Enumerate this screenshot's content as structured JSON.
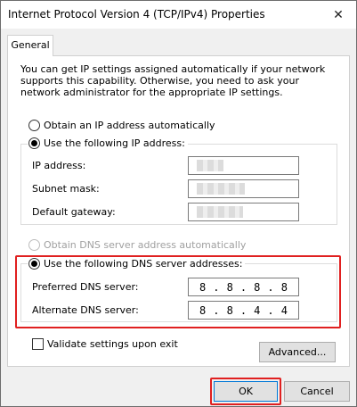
{
  "window": {
    "title": "Internet Protocol Version 4 (TCP/IPv4) Properties",
    "close_glyph": "✕"
  },
  "tabs": [
    {
      "label": "General"
    }
  ],
  "description": "You can get IP settings assigned automatically if your network supports this capability. Otherwise, you need to ask your network administrator for the appropriate IP settings.",
  "ip": {
    "auto_label": "Obtain an IP address automatically",
    "manual_label": "Use the following IP address:",
    "fields": [
      {
        "label": "IP address:"
      },
      {
        "label": "Subnet mask:"
      },
      {
        "label": "Default gateway:"
      }
    ]
  },
  "dns": {
    "auto_label": "Obtain DNS server address automatically",
    "manual_label": "Use the following DNS server addresses:",
    "preferred_label": "Preferred DNS server:",
    "preferred_octets": [
      "8",
      "8",
      "8",
      "8"
    ],
    "alternate_label": "Alternate DNS server:",
    "alternate_octets": [
      "8",
      "8",
      "4",
      "4"
    ]
  },
  "validate_label": "Validate settings upon exit",
  "buttons": {
    "advanced": "Advanced...",
    "ok": "OK",
    "cancel": "Cancel"
  },
  "colors": {
    "highlight": "#e02020"
  }
}
